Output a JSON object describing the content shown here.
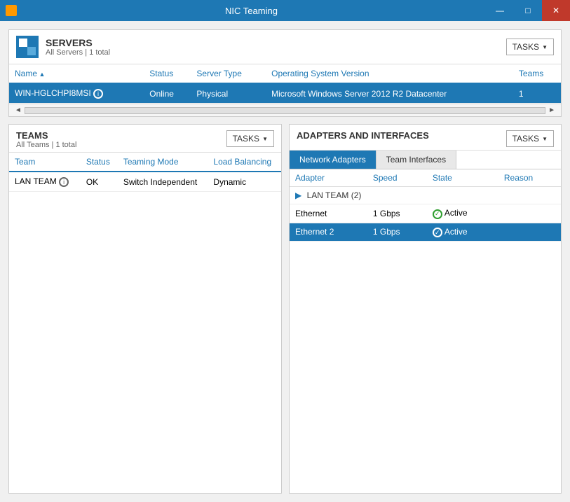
{
  "window": {
    "title": "NIC Teaming",
    "controls": {
      "minimize": "—",
      "maximize": "□",
      "close": "✕"
    }
  },
  "servers": {
    "title": "SERVERS",
    "subtitle": "All Servers | 1 total",
    "tasks_label": "TASKS",
    "columns": [
      {
        "label": "Name",
        "sorted": true
      },
      {
        "label": "Status"
      },
      {
        "label": "Server Type"
      },
      {
        "label": "Operating System Version"
      },
      {
        "label": "Teams"
      }
    ],
    "rows": [
      {
        "name": "WIN-HGLCHPI8MSI",
        "status": "Online",
        "server_type": "Physical",
        "os_version": "Microsoft Windows Server 2012 R2 Datacenter",
        "teams": "1",
        "selected": true
      }
    ]
  },
  "teams": {
    "title": "TEAMS",
    "subtitle": "All Teams | 1 total",
    "tasks_label": "TASKS",
    "columns": [
      {
        "label": "Team"
      },
      {
        "label": "Status"
      },
      {
        "label": "Teaming Mode"
      },
      {
        "label": "Load Balancing"
      }
    ],
    "rows": [
      {
        "team": "LAN TEAM",
        "status": "OK",
        "teaming_mode": "Switch Independent",
        "load_balancing": "Dynamic",
        "selected": false
      }
    ]
  },
  "adapters": {
    "title": "ADAPTERS AND INTERFACES",
    "tasks_label": "TASKS",
    "tabs": [
      {
        "label": "Network Adapters",
        "active": true
      },
      {
        "label": "Team Interfaces",
        "active": false
      }
    ],
    "columns": [
      {
        "label": "Adapter"
      },
      {
        "label": "Speed"
      },
      {
        "label": "State"
      },
      {
        "label": "Reason"
      }
    ],
    "groups": [
      {
        "name": "LAN TEAM (2)",
        "rows": [
          {
            "adapter": "Ethernet",
            "speed": "1 Gbps",
            "state": "Active",
            "reason": "",
            "selected": false
          },
          {
            "adapter": "Ethernet 2",
            "speed": "1 Gbps",
            "state": "Active",
            "reason": "",
            "selected": true
          }
        ]
      }
    ]
  }
}
